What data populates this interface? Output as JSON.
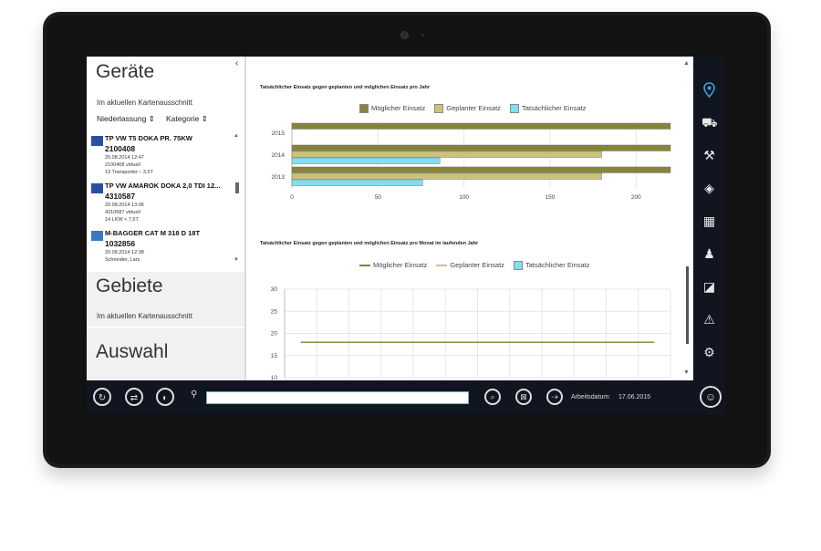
{
  "left_panel": {
    "devices_title": "Geräte",
    "devices_subtitle": "Im aktuellen Kartenausschnitt",
    "filter_branch": "Niederlassung",
    "filter_category": "Kategorie",
    "devices": [
      {
        "name": "TP VW T5 DOKA PR. 75KW",
        "number": "2100408",
        "line1": "20.08.2014 12:47",
        "line2": "2100408 virtuell",
        "line3": "13 Transporter – 3,5T"
      },
      {
        "name": "TP VW AMAROK DOKA 2,0 TDI 12...",
        "number": "4310587",
        "line1": "20.08.2014 13:06",
        "line2": "4310587 virtuell",
        "line3": "14 LKW < 7,5T"
      },
      {
        "name": "M-BAGGER CAT M 318 D 18T",
        "number": "1032856",
        "line1": "20.08.2014 12:38",
        "line2": "Schneider, Lars",
        "line3": ""
      }
    ],
    "areas_title": "Gebiete",
    "areas_subtitle": "Im aktuellen Kartenausschnitt",
    "selection_title": "Auswahl"
  },
  "charts": {
    "chart1_title": "Tatsächlicher Einsatz gegen geplanten und möglichen Einsatz pro Jahr",
    "chart2_title": "Tatsächlicher Einsatz gegen geplanten und möglichen Einsatz pro Monat im laufenden Jahr"
  },
  "chart_data": [
    {
      "type": "bar",
      "orientation": "horizontal",
      "title": "Tatsächlicher Einsatz gegen geplanten und möglichen Einsatz pro Jahr",
      "categories": [
        "2015",
        "2014",
        "2013"
      ],
      "series": [
        {
          "name": "Möglicher Einsatz",
          "color": "#86843a",
          "values": [
            220,
            220,
            220
          ]
        },
        {
          "name": "Geplanter Einsatz",
          "color": "#c9c47a",
          "values": [
            null,
            180,
            180
          ]
        },
        {
          "name": "Tatsächlicher Einsatz",
          "color": "#7ee0f0",
          "values": [
            null,
            86,
            76
          ]
        }
      ],
      "xlim": [
        0,
        220
      ],
      "xticks": [
        0,
        50,
        100,
        150,
        200
      ],
      "legend": "top",
      "grid": true
    },
    {
      "type": "line",
      "title": "Tatsächlicher Einsatz gegen geplanten und möglichen Einsatz pro Monat im laufenden Jahr",
      "series": [
        {
          "name": "Möglicher Einsatz",
          "color": "#7a8a2a",
          "values": [
            18,
            18,
            18,
            18,
            18,
            18,
            18,
            18,
            18,
            18,
            18,
            18
          ]
        },
        {
          "name": "Geplanter Einsatz",
          "color": "#c9c47a",
          "values": []
        },
        {
          "name": "Tatsächlicher Einsatz",
          "color": "#7ee0f0",
          "values": []
        }
      ],
      "yticks": [
        10,
        15,
        20,
        25,
        30
      ],
      "legend": "top",
      "grid": true
    }
  ],
  "bottom_bar": {
    "date_label": "Arbeitsdatum:",
    "date_value": "17.06.2015"
  },
  "colors": {
    "accent": "#3aa3d6",
    "bar_dark": "#86843a",
    "bar_light": "#c9c47a",
    "bar_cyan": "#7ee0f0"
  }
}
